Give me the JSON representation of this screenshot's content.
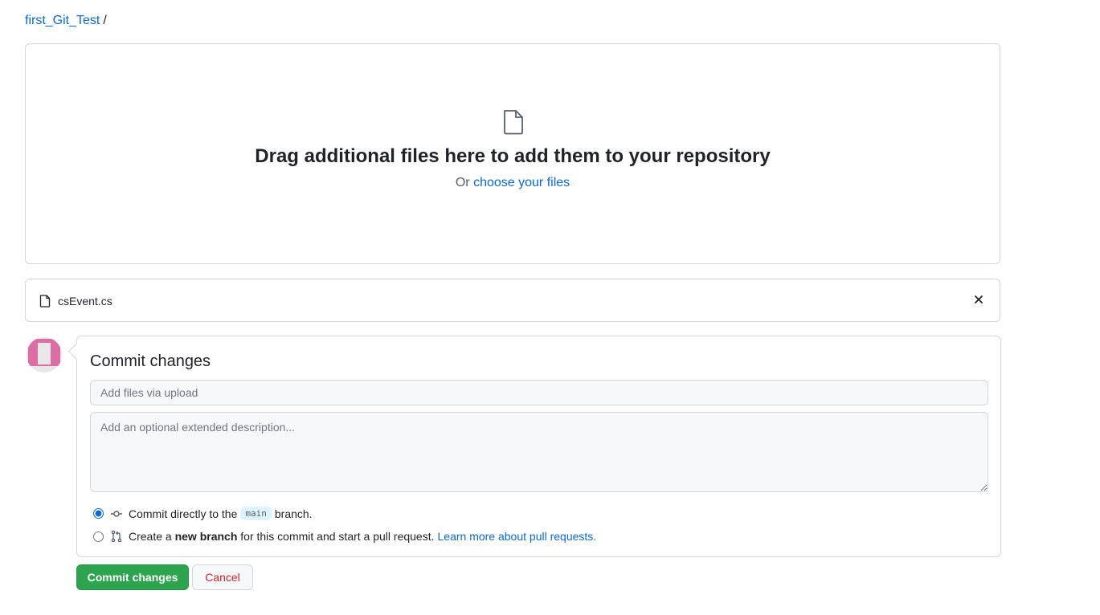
{
  "breadcrumb": {
    "repo": "first_Git_Test",
    "separator": "/"
  },
  "dropzone": {
    "icon": "file-icon",
    "title": "Drag additional files here to add them to your repository",
    "or_label": "Or",
    "choose_link": "choose your files"
  },
  "files": [
    {
      "icon": "file-icon",
      "name": "csEvent.cs",
      "remove_icon": "x-icon"
    }
  ],
  "commit": {
    "avatar_colors": {
      "primary": "#dd6da4",
      "background": "#e8e8e8"
    },
    "title": "Commit changes",
    "summary_placeholder": "Add files via upload",
    "summary_value": "",
    "description_placeholder": "Add an optional extended description...",
    "description_value": "",
    "options": [
      {
        "selected": true,
        "icon": "git-commit-icon",
        "text_before": "Commit directly to the",
        "branch": "main",
        "text_after": "branch."
      },
      {
        "selected": false,
        "icon": "git-pull-request-icon",
        "text_before": "Create a",
        "bold": "new branch",
        "text_after": "for this commit and start a pull request.",
        "link": "Learn more about pull requests."
      }
    ],
    "submit_label": "Commit changes",
    "cancel_label": "Cancel"
  },
  "colors": {
    "link": "#0969da",
    "primary_button": "#2da44e",
    "danger_text": "#cf222e",
    "border": "#d0d7de"
  }
}
